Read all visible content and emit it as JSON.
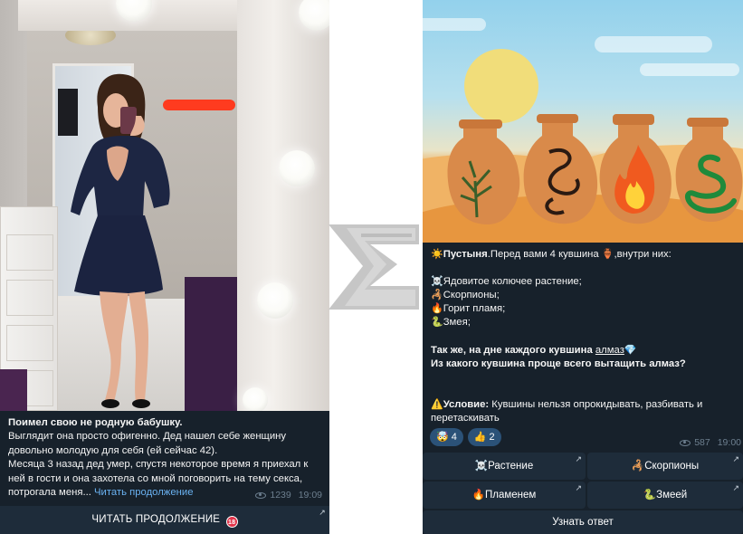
{
  "left_post": {
    "title": "Поимел свою не родную бабушку.",
    "paragraph1": "Выглядит она просто офигенно. Дед нашел себе женщину довольно молодую для себя (ей сейчас 42).",
    "paragraph2": "Месяца 3 назад дед умер, спустя некоторое время я приехал к ней в гости и она захотела со мной поговорить на тему секса, потрогала меня...",
    "read_more_link": "Читать продолжение",
    "views": "1239",
    "time": "19:09",
    "button_label": "ЧИТАТЬ ПРОДОЛЖЕНИЕ",
    "button_badge": "18",
    "button_arrow": "↗"
  },
  "right_post": {
    "intro_bold": "Пустыня",
    "intro_rest": ".Перед вами 4 кувшина",
    "intro_tail": ",внутри них:",
    "items": [
      {
        "emoji": "☠️",
        "text": "Ядовитое колючее растение;"
      },
      {
        "emoji": "🦂",
        "text": "Скорпионы;"
      },
      {
        "emoji": "🔥",
        "text": "Горит пламя;"
      },
      {
        "emoji": "🐍",
        "text": "Змея;"
      }
    ],
    "line_bottom_a": "Так же, на дне каждого кувшина ",
    "line_bottom_link": "алмаз",
    "line_bottom_b": "Из какого кувшина проще всего вытащить алмаз?",
    "condition_label": "Условие:",
    "condition_text": " Кувшины нельзя опрокидывать, разбивать и",
    "condition_text2": "перетаскивать",
    "reactions": [
      {
        "emoji": "🤯",
        "count": "4"
      },
      {
        "emoji": "👍",
        "count": "2"
      }
    ],
    "views": "587",
    "time": "19:00",
    "buttons": [
      {
        "emoji": "☠️",
        "label": "Растение"
      },
      {
        "emoji": "🦂",
        "label": "Скорпионы"
      },
      {
        "emoji": "🔥",
        "label": "Пламенем"
      },
      {
        "emoji": "🐍",
        "label": "Змеей"
      }
    ],
    "answer_button": "Узнать ответ",
    "button_arrow": "↗"
  },
  "colors": {
    "chat_bg": "#17212b",
    "button_bg": "#1e2c3a",
    "link": "#6ab2f2",
    "reaction_bg": "#2b5278",
    "meta": "#6d7f8f"
  }
}
